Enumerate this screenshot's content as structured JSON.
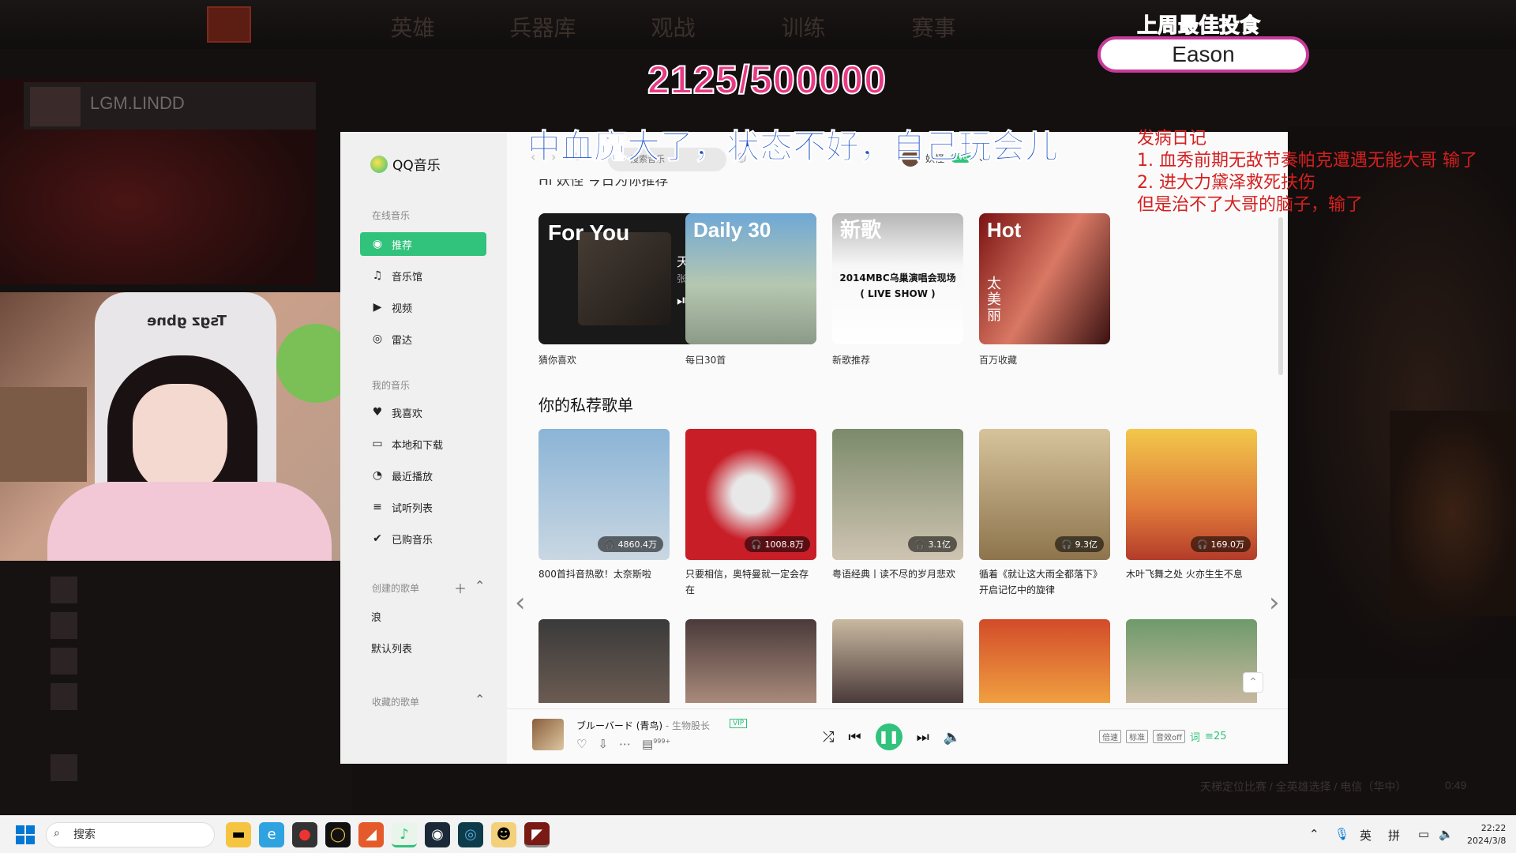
{
  "game": {
    "nav": [
      "英雄",
      "兵器库",
      "观战",
      "训练",
      "赛事"
    ],
    "player_name": "LGM.LINDD",
    "status_text": "天梯定位比赛 / 全英雄选择 / 电信（华中）",
    "timer": "0:49"
  },
  "overlay": {
    "counter": "2125/500000",
    "best_title": "上周最佳投食",
    "best_name": "Eason",
    "banner": "中血魔大了，状态不好，自己玩会儿",
    "diary_title": "发病日记",
    "diary_lines": [
      "1. 血秀前期无敌节奏帕克遭遇无能大哥  输了",
      "2. 进大力黛泽救死扶伤",
      "但是治不了大哥的脑子，输了"
    ]
  },
  "webcam": {
    "chair_text": "Tsgz gbne"
  },
  "qqmusic": {
    "app_name": "QQ音乐",
    "search_placeholder": "搜索音乐",
    "user_name": "妖怪",
    "user_badge": "Lv6",
    "sidebar": {
      "online_section": "在线音乐",
      "online_items": [
        {
          "label": "推荐",
          "icon": "recommend-icon",
          "glyph": "◉"
        },
        {
          "label": "音乐馆",
          "icon": "music-note-icon",
          "glyph": "♫"
        },
        {
          "label": "视频",
          "icon": "video-icon",
          "glyph": "▶"
        },
        {
          "label": "雷达",
          "icon": "radar-icon",
          "glyph": "◎"
        }
      ],
      "my_section": "我的音乐",
      "my_items": [
        {
          "label": "我喜欢",
          "icon": "heart-icon",
          "glyph": "♥"
        },
        {
          "label": "本地和下载",
          "icon": "monitor-icon",
          "glyph": "▭"
        },
        {
          "label": "最近播放",
          "icon": "clock-icon",
          "glyph": "◔"
        },
        {
          "label": "试听列表",
          "icon": "list-icon",
          "glyph": "≡"
        },
        {
          "label": "已购音乐",
          "icon": "check-icon",
          "glyph": "✔"
        }
      ],
      "created_section": "创建的歌单",
      "created_items": [
        "浪",
        "默认列表"
      ],
      "collected_section": "收藏的歌单"
    },
    "cut_title": "Hi 妖怪 今日为你推荐",
    "featured": [
      {
        "big": "For You",
        "song": "天下",
        "artist": "张杰",
        "label": "猜你喜欢"
      },
      {
        "big": "Daily 30",
        "label": "每日30首"
      },
      {
        "big": "新歌",
        "live": "2014MBC乌巢演唱会现场\n( LIVE SHOW )",
        "label": "新歌推荐"
      },
      {
        "big": "Hot",
        "vertical": "太美丽",
        "label": "百万收藏"
      }
    ],
    "section_title": "你的私荐歌单",
    "playlists": [
      {
        "count": "4860.4万",
        "title": "800首抖音热歌！太奈斯啦",
        "color": "#8bb4d6"
      },
      {
        "count": "1008.8万",
        "title": "只要相信，奥特曼就一定会存在",
        "color": "#c81e28"
      },
      {
        "count": "3.1亿",
        "title": "粤语经典丨读不尽的岁月悲欢",
        "color": "#7b8a6a"
      },
      {
        "count": "9.3亿",
        "title": "循着《就让这大雨全都落下》开启记忆中的旋律",
        "color": "#b0936a"
      },
      {
        "count": "169.0万",
        "title": "木叶飞舞之处 火亦生生不息",
        "color": "#e9a04a"
      }
    ],
    "player": {
      "title": "ブルーバード (青鸟)",
      "artist": "生物股长",
      "comment_count": "999+",
      "speed": "倍速",
      "quality": "标准",
      "effect": "音效off",
      "lyrics": "词",
      "queue": "25"
    }
  },
  "taskbar": {
    "search": "搜索",
    "ime1": "英",
    "ime2": "拼",
    "time": "22:22",
    "date": "2024/3/8"
  }
}
